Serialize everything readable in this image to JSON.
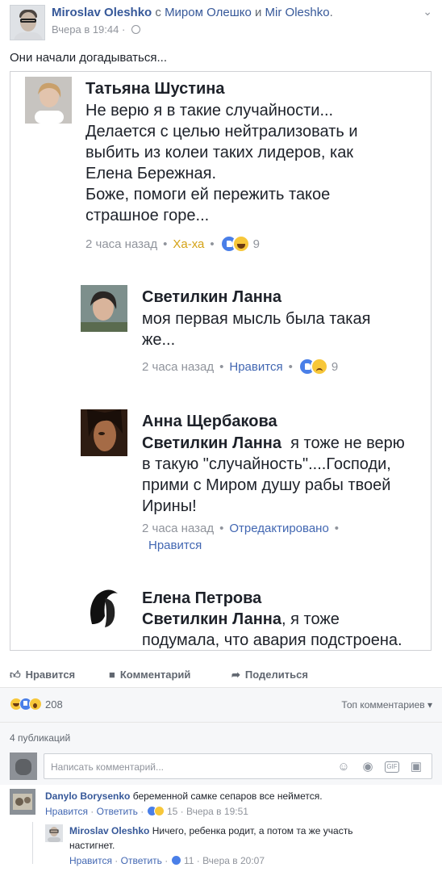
{
  "post": {
    "author": "Miroslav Oleshko",
    "with_word": "с",
    "tagged1": "Миром Олешко",
    "and_word": "и",
    "tagged2": "Mir Oleshko",
    "trailing": ".",
    "time": "Вчера в 19:44",
    "dot": "·",
    "text": "Они начали догадываться..."
  },
  "screenshot": {
    "comment1": {
      "name": "Татьяна Шустина",
      "lines": [
        "Не верю я в такие случайности...",
        "Делается с целью нейтрализовать и",
        "выбить из колеи таких лидеров, как",
        "Елена Бережная.",
        "Боже, помоги ей пережить такое",
        "страшное горе..."
      ],
      "time": "2 часа назад",
      "action": "Ха-ха",
      "count": "9"
    },
    "comment2": {
      "name": "Светилкин Ланна",
      "lines": [
        "моя первая мысль была такая",
        "же..."
      ],
      "time": "2 часа назад",
      "action": "Нравится",
      "count": "9"
    },
    "comment3": {
      "name": "Анна Щербакова",
      "mention": "Светилкин Ланна",
      "line1_rest": "  я тоже не верю",
      "lines": [
        "в такую \"случайность\"....Господи,",
        "прими с Миром душу рабы твоей",
        "Ирины!"
      ],
      "time": "2 часа назад",
      "edited": "Отредактировано",
      "action": "Нравится"
    },
    "comment4": {
      "name": "Елена Петрова",
      "mention": "Светилкин Ланна",
      "line1_rest": ", я тоже",
      "line2": "подумала, что авария подстроена."
    }
  },
  "actions": {
    "like": "Нравится",
    "comment": "Комментарий",
    "share": "Поделиться"
  },
  "summary": {
    "count": "208",
    "top_comments": "Топ комментариев ▾",
    "publications": "4 публикаций"
  },
  "composer": {
    "placeholder": "Написать комментарий..."
  },
  "comments": [
    {
      "name": "Danylo Borysenko",
      "text": " беременной самке сепаров все неймется.",
      "like": "Нравится",
      "reply": "Ответить",
      "count": "15",
      "time": "Вчера в 19:51"
    },
    {
      "name": "Miroslav Oleshko",
      "text": " Ничего, ребенка родит, а потом та же участь",
      "text2": "настигнет.",
      "like": "Нравится",
      "reply": "Ответить",
      "count": "11",
      "time": "Вчера в 20:07"
    }
  ],
  "colors": {
    "link": "#365899",
    "action": "#4267b2",
    "meta": "#90949c",
    "like_blue": "#4a7fe8",
    "haha_yellow": "#f7c73a"
  }
}
